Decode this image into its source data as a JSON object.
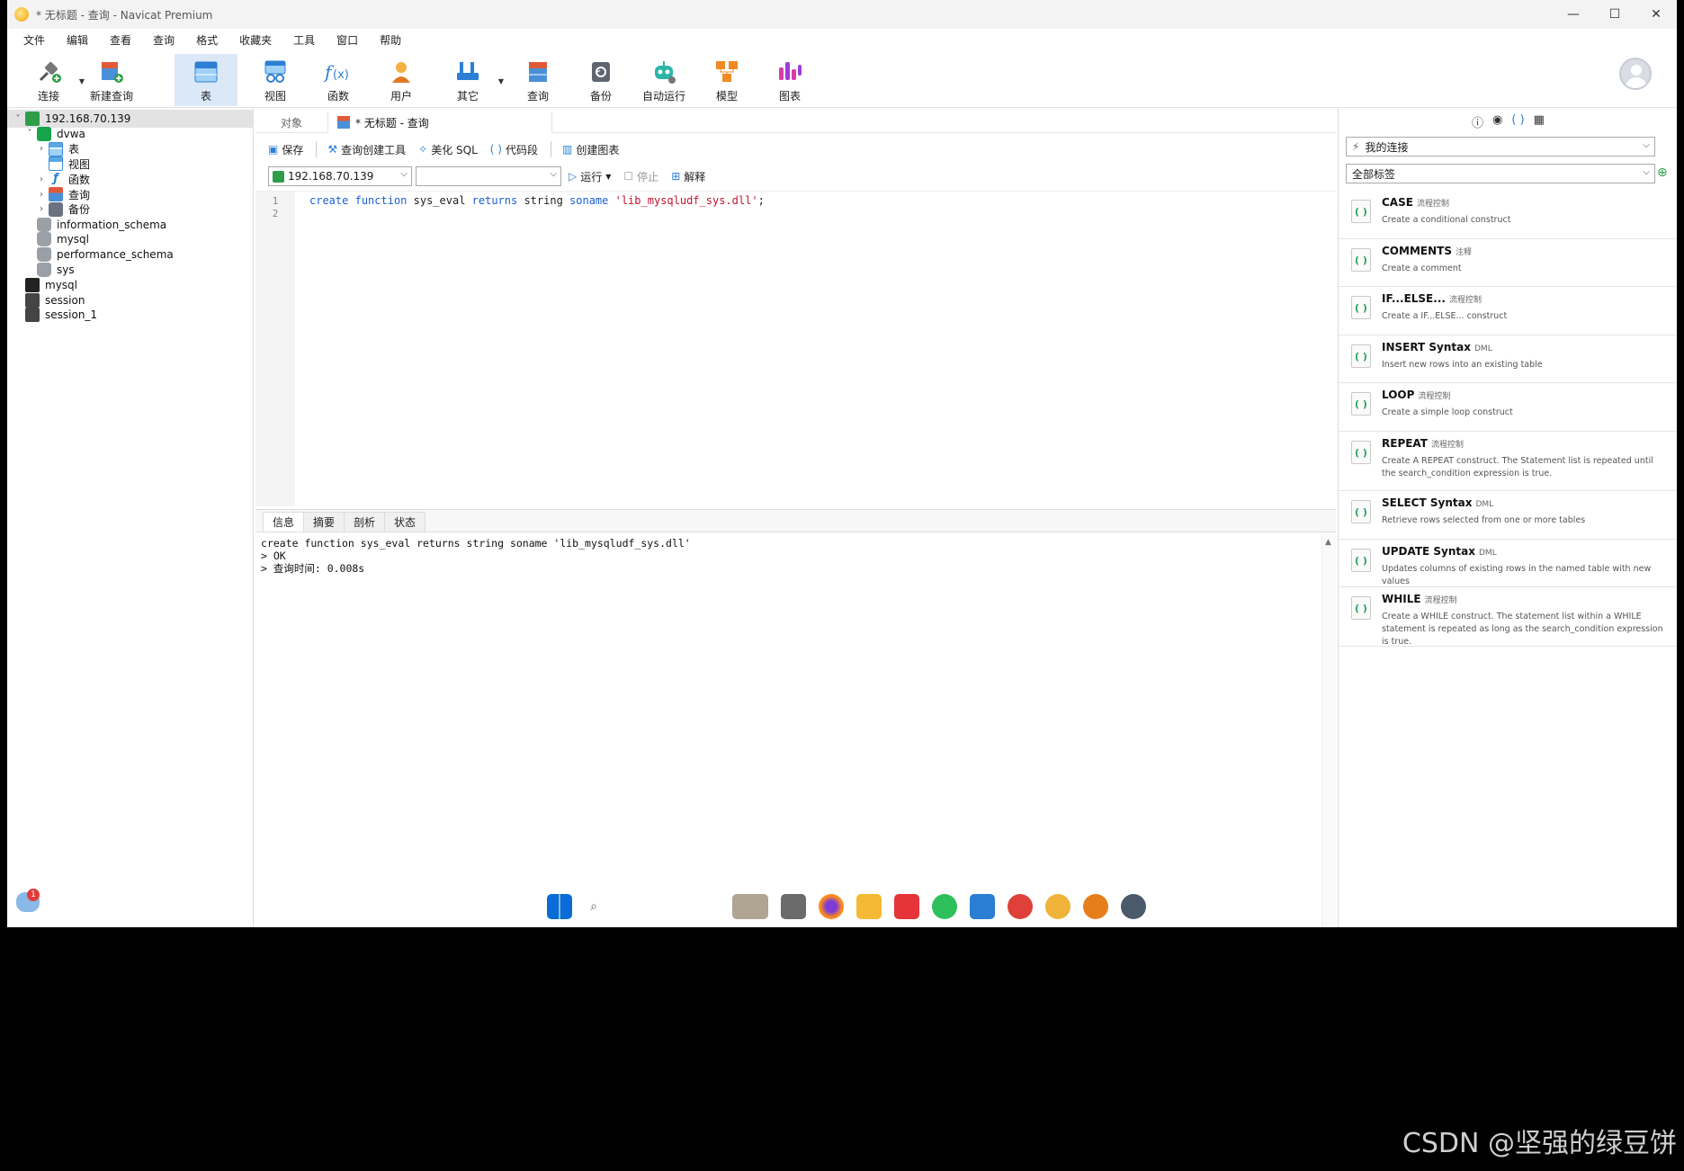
{
  "window": {
    "title": "* 无标题 - 查询 - Navicat Premium",
    "controls": [
      "—",
      "☐",
      "✕"
    ]
  },
  "menu": [
    "文件",
    "编辑",
    "查看",
    "查询",
    "格式",
    "收藏夹",
    "工具",
    "窗口",
    "帮助"
  ],
  "toolbar": [
    {
      "label": "连接",
      "icon": "connection-icon",
      "has_caret": true
    },
    {
      "label": "新建查询",
      "icon": "new-query-icon"
    },
    {
      "label": "表",
      "icon": "table-icon",
      "active": true
    },
    {
      "label": "视图",
      "icon": "view-icon"
    },
    {
      "label": "函数",
      "icon": "function-icon"
    },
    {
      "label": "用户",
      "icon": "user-icon"
    },
    {
      "label": "其它",
      "icon": "other-icon",
      "has_caret": true
    },
    {
      "label": "查询",
      "icon": "query-icon"
    },
    {
      "label": "备份",
      "icon": "backup-icon"
    },
    {
      "label": "自动运行",
      "icon": "robot-icon"
    },
    {
      "label": "模型",
      "icon": "model-icon"
    },
    {
      "label": "图表",
      "icon": "chart-icon"
    }
  ],
  "tree": [
    {
      "label": "192.168.70.139",
      "level": 0,
      "icon": "conn",
      "twisty": "˅",
      "selected": true
    },
    {
      "label": "dvwa",
      "level": 1,
      "icon": "db-green",
      "twisty": "˅"
    },
    {
      "label": "表",
      "level": 2,
      "icon": "table",
      "twisty": "›"
    },
    {
      "label": "视图",
      "level": 2,
      "icon": "view",
      "twisty": ""
    },
    {
      "label": "函数",
      "level": 2,
      "icon": "func",
      "twisty": "›"
    },
    {
      "label": "查询",
      "level": 2,
      "icon": "query",
      "twisty": "›"
    },
    {
      "label": "备份",
      "level": 2,
      "icon": "backup",
      "twisty": "›"
    },
    {
      "label": "information_schema",
      "level": 1,
      "icon": "db-grey",
      "twisty": ""
    },
    {
      "label": "mysql",
      "level": 1,
      "icon": "db-grey",
      "twisty": ""
    },
    {
      "label": "performance_schema",
      "level": 1,
      "icon": "db-grey",
      "twisty": ""
    },
    {
      "label": "sys",
      "level": 1,
      "icon": "db-grey",
      "twisty": ""
    },
    {
      "label": "mysql",
      "level": 0,
      "icon": "mysql",
      "twisty": ""
    },
    {
      "label": "session",
      "level": 0,
      "icon": "sess",
      "twisty": ""
    },
    {
      "label": "session_1",
      "level": 0,
      "icon": "sess",
      "twisty": ""
    }
  ],
  "tabs": {
    "objects": "对象",
    "query": "* 无标题 - 查询"
  },
  "query_toolbar": {
    "save": "保存",
    "query_builder": "查询创建工具",
    "beautify": "美化 SQL",
    "snippet": "代码段",
    "create_chart": "创建图表"
  },
  "selectors": {
    "connection": "192.168.70.139",
    "database": "",
    "run": "运行",
    "stop": "停止",
    "explain": "解释"
  },
  "editor": {
    "line_numbers": [
      "1",
      "2"
    ],
    "tokens": [
      {
        "t": "create",
        "c": "kw"
      },
      {
        "t": " ",
        "c": "plain"
      },
      {
        "t": "function",
        "c": "kw"
      },
      {
        "t": " sys_eval ",
        "c": "plain"
      },
      {
        "t": "returns",
        "c": "kw"
      },
      {
        "t": " string ",
        "c": "plain"
      },
      {
        "t": "soname",
        "c": "kw"
      },
      {
        "t": " ",
        "c": "plain"
      },
      {
        "t": "'lib_mysqludf_sys.dll'",
        "c": "str"
      },
      {
        "t": ";",
        "c": "plain"
      }
    ]
  },
  "result_tabs": [
    "信息",
    "摘要",
    "剖析",
    "状态"
  ],
  "output": "create function sys_eval returns string soname 'lib_mysqludf_sys.dll'\n> OK\n> 查询时间: 0.008s",
  "right_panel": {
    "connection_combo": "我的连接",
    "tag_combo": "全部标签",
    "snippets": [
      {
        "title": "CASE",
        "tag": "流程控制",
        "desc": "Create a conditional construct"
      },
      {
        "title": "COMMENTS",
        "tag": "注释",
        "desc": "Create a comment"
      },
      {
        "title": "IF...ELSE...",
        "tag": "流程控制",
        "desc": "Create a IF...ELSE... construct"
      },
      {
        "title": "INSERT Syntax",
        "tag": "DML",
        "desc": "Insert new rows into an existing table"
      },
      {
        "title": "LOOP",
        "tag": "流程控制",
        "desc": "Create a simple loop construct"
      },
      {
        "title": "REPEAT",
        "tag": "流程控制",
        "desc": "Create A REPEAT construct. The Statement list is repeated until the search_condition expression is true."
      },
      {
        "title": "SELECT Syntax",
        "tag": "DML",
        "desc": "Retrieve rows selected from one or more tables"
      },
      {
        "title": "UPDATE Syntax",
        "tag": "DML",
        "desc": "Updates columns of existing rows in the named table with new values"
      },
      {
        "title": "WHILE",
        "tag": "流程控制",
        "desc": "Create a WHILE construct. The statement list within a WHILE statement is repeated as long as the search_condition expression is true."
      }
    ]
  },
  "taskbar": {
    "notification_count": "1"
  },
  "watermark": "CSDN @坚强的绿豆饼"
}
